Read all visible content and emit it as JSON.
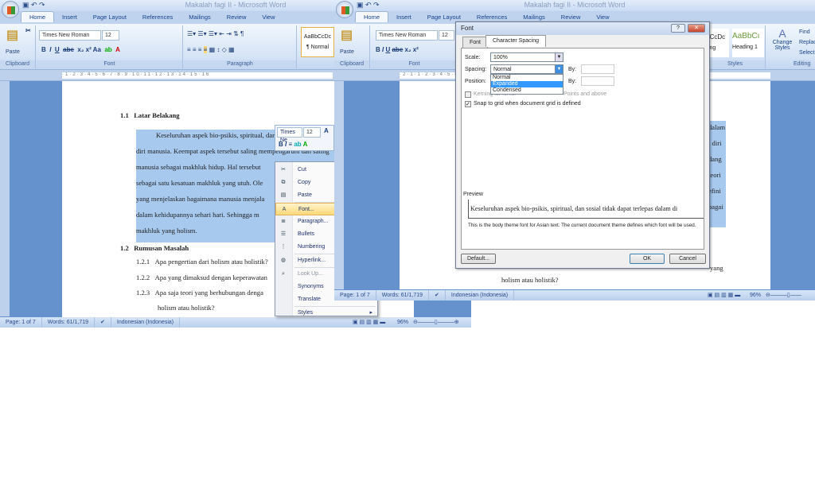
{
  "left_window": {
    "title": "Makalah fagi II - Microsoft Word",
    "tabs": [
      "Home",
      "Insert",
      "Page Layout",
      "References",
      "Mailings",
      "Review",
      "View"
    ],
    "font_name": "Times New Roman",
    "font_size": "12",
    "groups": {
      "clipboard": "Clipboard",
      "font": "Font",
      "paragraph": "Paragraph"
    },
    "paste": "Paste",
    "style_preview": "AaBbCcDc",
    "style_name": "¶ Normal",
    "doc": {
      "h1": "1.1",
      "h1_title": "Latar Belakang",
      "para": [
        "Keseluruhan aspek bio-psikis, spiritual, dan",
        "diri manusia. Keempat aspek tersebut saling mempengaruhi dan saling",
        "manusia sebagai makhluk hidup. Hal tersebut",
        "sebagai satu kesatuan makhluk yang utuh. Ole",
        "yang menjelaskan bagaimana manusia menjala",
        "dalam kehidupannya sehari hari. Sehingga m",
        "makhluk yang holism."
      ],
      "h2": "1.2",
      "h2_title": "Rumusan Masalah",
      "items": [
        [
          "1.2.1",
          "Apa pengertian dari holism atau holistik?"
        ],
        [
          "1.2.2",
          "Apa yang dimaksud dengan keperawatan"
        ],
        [
          "1.2.3",
          "Apa saja teori yang berhubungan denga"
        ]
      ],
      "item3_cont": "holism atau holistik?"
    },
    "status": {
      "page": "Page: 1 of 7",
      "words": "Words: 61/1,719",
      "language": "Indonesian (Indonesia)",
      "zoom": "96%"
    }
  },
  "mini_toolbar": {
    "font": "Times Ne",
    "size": "12"
  },
  "context_menu": [
    {
      "label": "Cut",
      "icon": "scissors-icon"
    },
    {
      "label": "Copy",
      "icon": "copy-icon"
    },
    {
      "label": "Paste",
      "icon": "paste-icon"
    },
    {
      "label": "Font...",
      "icon": "font-icon",
      "highlighted": true
    },
    {
      "label": "Paragraph...",
      "icon": "paragraph-icon"
    },
    {
      "label": "Bullets",
      "icon": "bullets-icon"
    },
    {
      "label": "Numbering",
      "icon": "numbering-icon"
    },
    {
      "label": "Hyperlink...",
      "icon": "hyperlink-icon"
    },
    {
      "label": "Look Up...",
      "icon": "lookup-icon",
      "disabled": true
    },
    {
      "label": "Synonyms",
      "icon": ""
    },
    {
      "label": "Translate",
      "icon": ""
    },
    {
      "label": "Styles",
      "icon": "",
      "submenu": true
    }
  ],
  "right_window": {
    "title": "Makalah fagi II - Microsoft Word",
    "tabs": [
      "Home",
      "Insert",
      "Page Layout",
      "References",
      "Mailings",
      "Review",
      "View"
    ],
    "font_name": "Times New Roman",
    "font_size": "12",
    "paste": "Paste",
    "clipboard": "Clipboard",
    "font_group": "Font",
    "styles": [
      {
        "preview": "AaBbCcDc",
        "name": "ding"
      },
      {
        "preview": "AaBbCı",
        "name": "Heading 1"
      }
    ],
    "styles_group": "Styles",
    "change_styles": "Change Styles",
    "editing": [
      "Find",
      "Replace",
      "Select"
    ],
    "editing_group": "Editing",
    "doc_right_fragments": [
      "dalam",
      "i diri",
      "dang",
      "teori",
      "efini",
      "bagai"
    ],
    "doc_bottom": [
      "yang",
      "holism atau holistik?"
    ],
    "status": {
      "page": "Page: 1 of 7",
      "words": "Words: 61/1,719",
      "language": "Indonesian (Indonesia)",
      "zoom": "96%"
    }
  },
  "font_dialog": {
    "title": "Font",
    "help": "?",
    "close": "✕",
    "tabs": [
      "Font",
      "Character Spacing"
    ],
    "scale_label": "Scale:",
    "scale_value": "100%",
    "spacing_label": "Spacing:",
    "spacing_value": "Normal",
    "by_label": "By:",
    "spacing_options": [
      "Normal",
      "Expanded",
      "Condensed"
    ],
    "selected_option": "Expanded",
    "position_label": "Position:",
    "by2_label": "By:",
    "kerning_label": "Kerning for fonts:",
    "points_label": "Points and above",
    "snap_label": "Snap to grid when document grid is defined",
    "snap_checked": true,
    "preview_label": "Preview",
    "preview_text": "Keseluruhan aspek bio-psikis, spiritual, dan sosial tidak dapat terlepas dalam di",
    "note": "This is the body theme font for Asian text. The current document theme defines which font will be used.",
    "default_btn": "Default...",
    "ok_btn": "OK",
    "cancel_btn": "Cancel"
  },
  "colors": {
    "ribbon_blue": "#6591cd",
    "selection": "#a8c9ee",
    "menu_highlight": "#ffd87a"
  }
}
